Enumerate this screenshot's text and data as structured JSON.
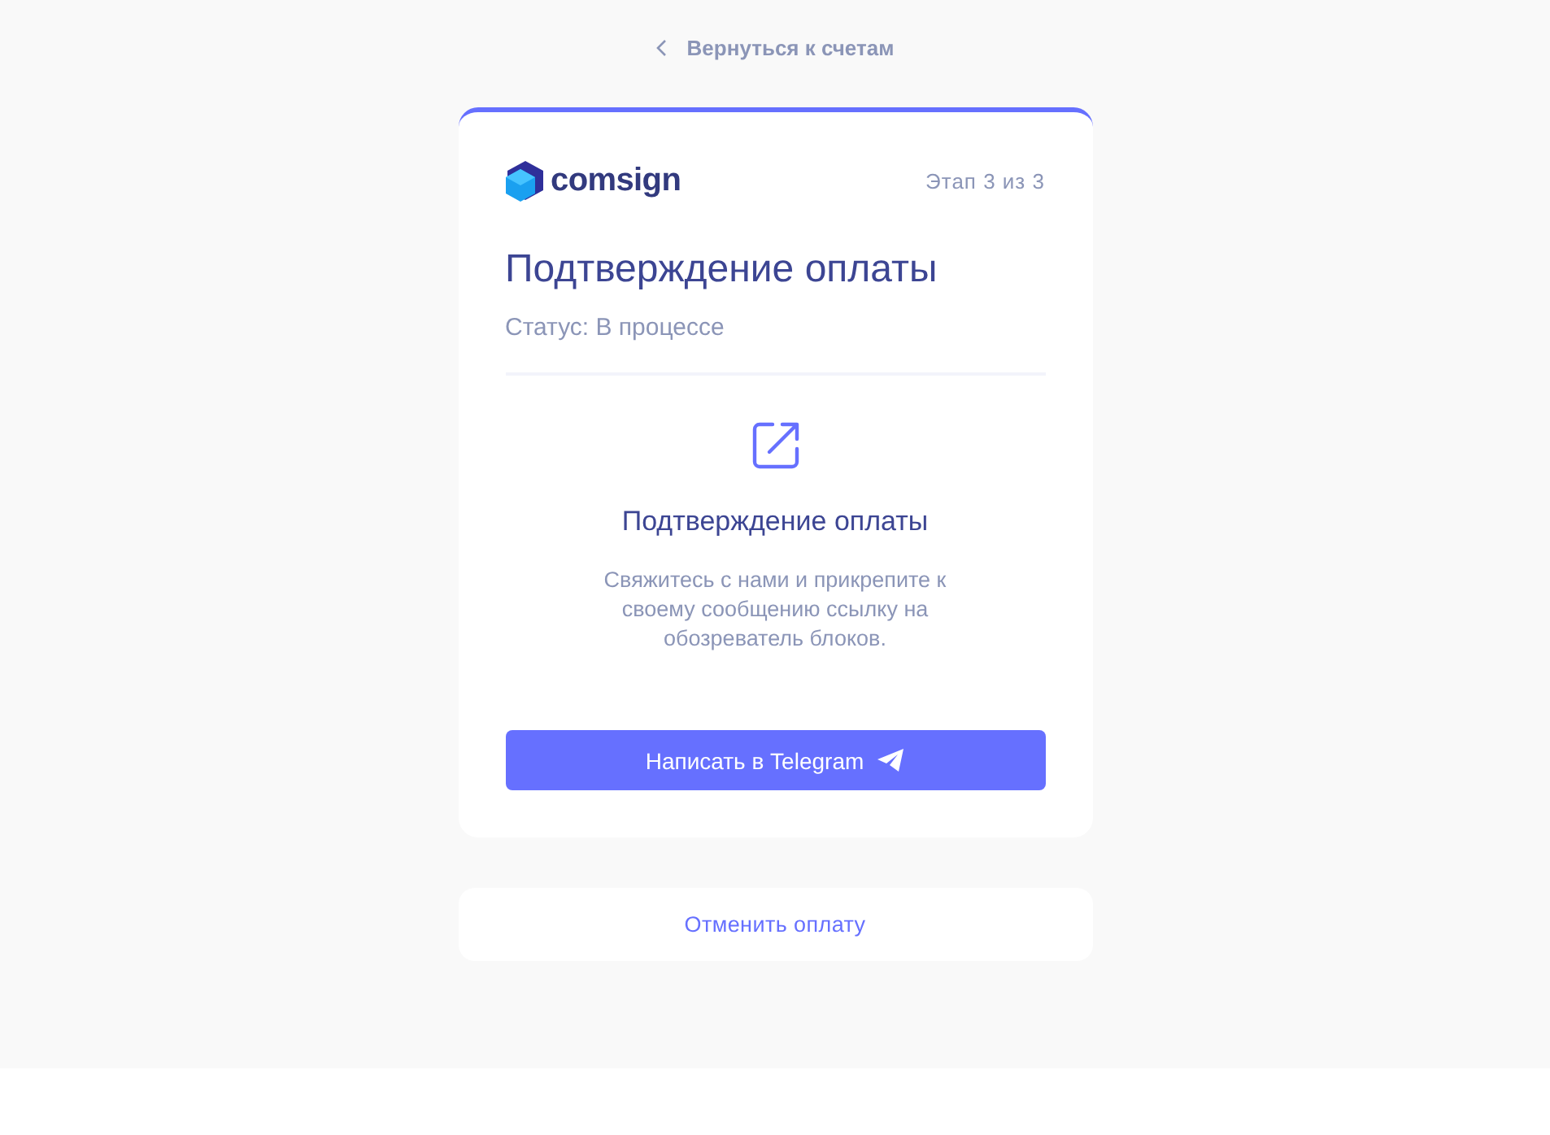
{
  "back_link": {
    "label": "Вернуться к счетам"
  },
  "card": {
    "brand": "comsign",
    "step": "Этап 3 из 3",
    "title": "Подтверждение оплаты",
    "status": "Статус: В процессе",
    "section_title": "Подтверждение оплаты",
    "description": "Свяжитесь с нами и прикрепите к своему сообщению ссылку на обозреватель блоков.",
    "button": "Написать в Telegram"
  },
  "cancel_link": {
    "label": "Отменить оплату"
  }
}
